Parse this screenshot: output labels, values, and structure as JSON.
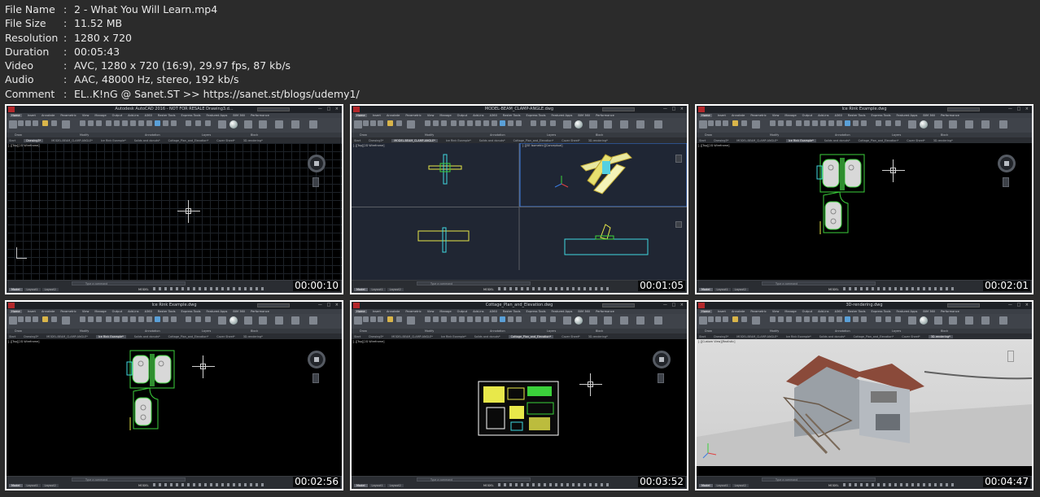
{
  "file_info": [
    {
      "key": "File Name",
      "value": "2 - What You Will Learn.mp4"
    },
    {
      "key": "File Size",
      "value": "11.52 MB"
    },
    {
      "key": "Resolution",
      "value": "1280 x 720"
    },
    {
      "key": "Duration",
      "value": "00:05:43"
    },
    {
      "key": "Video",
      "value": "AVC, 1280 x 720 (16:9), 29.97 fps, 87 kb/s"
    },
    {
      "key": "Audio",
      "value": "AAC, 48000 Hz, stereo, 192 kb/s"
    },
    {
      "key": "Comment",
      "value": "EL..K!nG @ Sanet.ST >> https://sanet.st/blogs/udemy1/"
    }
  ],
  "separator": ":",
  "ribbon": {
    "menu": [
      "Home",
      "Insert",
      "Annotate",
      "Parametric",
      "View",
      "Manage",
      "Output",
      "Add-ins",
      "A360",
      "Raster Tools",
      "Express Tools",
      "Featured Apps",
      "BIM 360",
      "Performance"
    ],
    "panels": [
      "Draw",
      "Modify",
      "Annotation",
      "Layers",
      "Block"
    ],
    "tools": [
      "Line",
      "Polyline",
      "Circle",
      "Arc",
      "Text",
      "Dimension",
      "Layer Properties",
      "Insert",
      "Properties",
      "Groups",
      "Utilities",
      "Clipboard",
      "View"
    ]
  },
  "command_placeholder": "Type a command",
  "model_label": "MODEL",
  "layout_tabs": [
    "Model",
    "Layout1",
    "Layout2"
  ],
  "search_placeholder": "Type a keyword or phrase",
  "thumbnails": [
    {
      "title": "Autodesk AutoCAD 2016 - NOT FOR RESALE    Drawing3.d...",
      "timestamp": "00:00:10",
      "viewport_label": "[-][Top][2D Wireframe]",
      "tabs": [
        "Start",
        "Drawing3*",
        "MODEL-BEAM_CLAMP-ANGLE*",
        "Ice Rink Example*",
        "Solids and donuts*",
        "Cottage_Plan_and_Elevation*",
        "Cover Sheet*",
        "3D-rendering*"
      ],
      "active_tab": 1,
      "scene": "grid"
    },
    {
      "title": "MODEL-BEAM_CLAMP-ANGLE.dwg",
      "timestamp": "00:01:05",
      "viewport_label": "[-][Top][2D Wireframe]",
      "viewport_label_2": "[-][SE Isometric][Conceptual]",
      "tabs": [
        "Start",
        "Drawing3*",
        "MODEL-BEAM_CLAMP-ANGLE*",
        "Ice Rink Example*",
        "Solids and donuts*",
        "Cottage_Plan_and_Elevation*",
        "Cover Sheet*",
        "3D-rendering*"
      ],
      "active_tab": 2,
      "scene": "beam"
    },
    {
      "title": "Ice Rink Example.dwg",
      "timestamp": "00:02:01",
      "viewport_label": "[-][Top][2D Wireframe]",
      "tabs": [
        "Start",
        "Drawing3*",
        "MODEL-BEAM_CLAMP-ANGLE*",
        "Ice Rink Example*",
        "Solids and donuts*",
        "Cottage_Plan_and_Elevation*",
        "Cover Sheet*",
        "3D-rendering*"
      ],
      "active_tab": 3,
      "scene": "rink"
    },
    {
      "title": "Ice Rink Example.dwg",
      "timestamp": "00:02:56",
      "viewport_label": "[-][Top][2D Wireframe]",
      "tabs": [
        "Start",
        "Drawing3*",
        "MODEL-BEAM_CLAMP-ANGLE*",
        "Ice Rink Example*",
        "Solids and donuts*",
        "Cottage_Plan_and_Elevation*",
        "Cover Sheet*",
        "3D-rendering*"
      ],
      "active_tab": 3,
      "scene": "rink"
    },
    {
      "title": "Cottage_Plan_and_Elevation.dwg",
      "timestamp": "00:03:52",
      "viewport_label": "[-][Top][2D Wireframe]",
      "tabs": [
        "Start",
        "Drawing3*",
        "MODEL-BEAM_CLAMP-ANGLE*",
        "Ice Rink Example*",
        "Solids and donuts*",
        "Cottage_Plan_and_Elevation*",
        "Cover Sheet*",
        "3D-rendering*"
      ],
      "active_tab": 5,
      "scene": "cottage"
    },
    {
      "title": "3D-rendering.dwg",
      "timestamp": "00:04:47",
      "viewport_label": "[-][Custom View][Realistic]",
      "tabs": [
        "Start",
        "Drawing3*",
        "MODEL-BEAM_CLAMP-ANGLE*",
        "Ice Rink Example*",
        "Solids and donuts*",
        "Cottage_Plan_and_Elevation*",
        "Cover Sheet*",
        "3D-rendering*"
      ],
      "active_tab": 7,
      "scene": "house"
    }
  ],
  "colors": {
    "background": "#2b2b2b",
    "frame": "#ffffff",
    "autocad_red": "#b4282b",
    "cad_green": "#3bd13b",
    "cad_yellow": "#e8e84a",
    "cad_cyan": "#3fd8e0",
    "roof": "#8a4a3a"
  }
}
